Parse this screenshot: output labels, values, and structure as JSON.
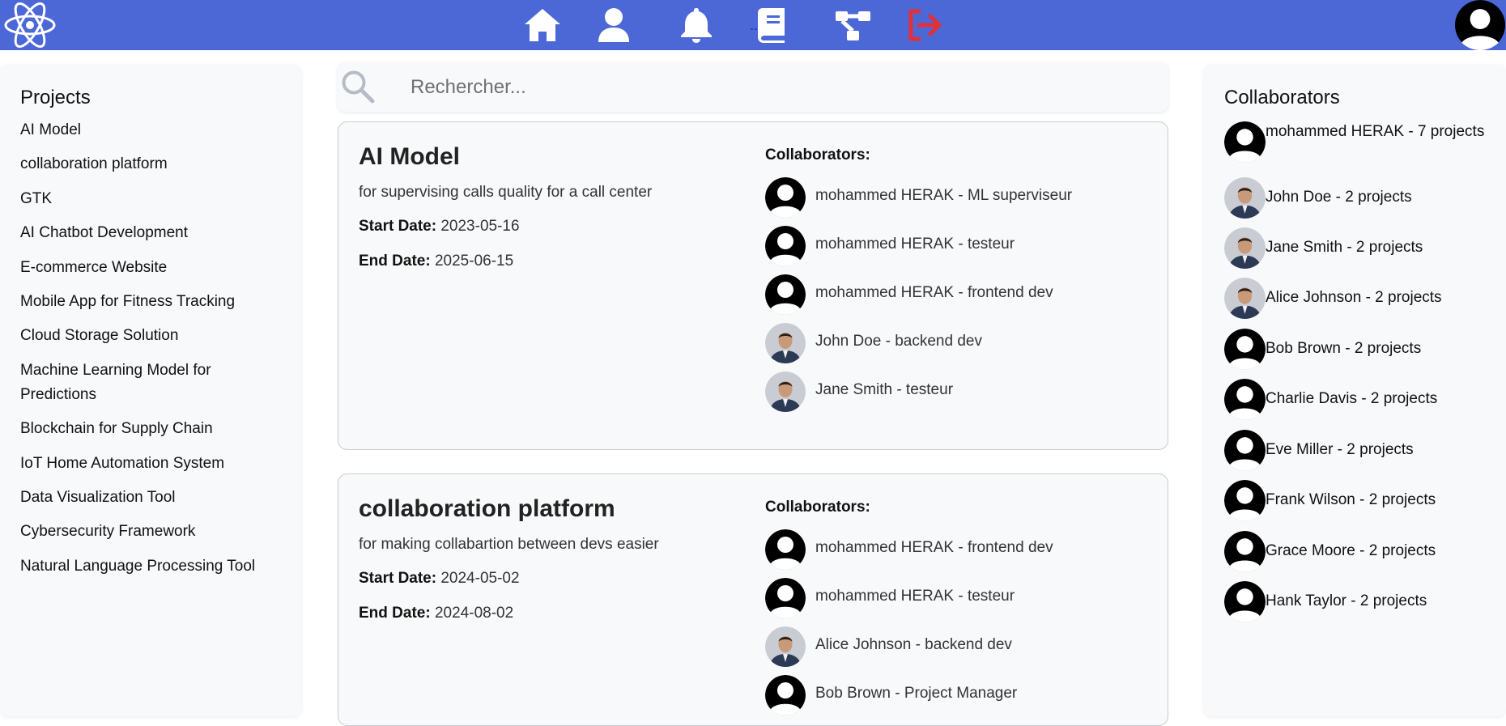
{
  "colors": {
    "topbar": "#4c68d7",
    "logout_icon": "#e0303a",
    "panel_bg": "#f8f9fb"
  },
  "nav": {
    "logo_icon": "atom-icon",
    "icons": [
      "home-icon",
      "user-icon",
      "bell-icon",
      "book-icon",
      "sitemap-icon",
      "logout-icon"
    ]
  },
  "projects_panel": {
    "title": "Projects",
    "items": [
      "AI Model",
      "collaboration platform",
      "GTK",
      "AI Chatbot Development",
      "E-commerce Website",
      "Mobile App for Fitness Tracking",
      "Cloud Storage Solution",
      "Machine Learning Model for Predictions",
      "Blockchain for Supply Chain",
      "IoT Home Automation System",
      "Data Visualization Tool",
      "Cybersecurity Framework",
      "Natural Language Processing Tool"
    ]
  },
  "search": {
    "placeholder": "Rechercher..."
  },
  "cards": [
    {
      "title": "AI Model",
      "description": "for supervising calls quality for a call center",
      "start_label": "Start Date:",
      "start_date": "2023-05-16",
      "end_label": "End Date:",
      "end_date": "2025-06-15",
      "collaborators_label": "Collaborators:",
      "collaborators": [
        {
          "name": "mohammed HERAK - ML superviseur",
          "avatar": "default"
        },
        {
          "name": "mohammed HERAK - testeur",
          "avatar": "default"
        },
        {
          "name": "mohammed HERAK - frontend dev",
          "avatar": "default"
        },
        {
          "name": "John Doe - backend dev",
          "avatar": "photo"
        },
        {
          "name": "Jane Smith - testeur",
          "avatar": "photo"
        }
      ]
    },
    {
      "title": "collaboration platform",
      "description": "for making collabartion between devs easier",
      "start_label": "Start Date:",
      "start_date": "2024-05-02",
      "end_label": "End Date:",
      "end_date": "2024-08-02",
      "collaborators_label": "Collaborators:",
      "collaborators": [
        {
          "name": "mohammed HERAK - frontend dev",
          "avatar": "default"
        },
        {
          "name": "mohammed HERAK - testeur",
          "avatar": "default"
        },
        {
          "name": "Alice Johnson - backend dev",
          "avatar": "photo"
        },
        {
          "name": "Bob Brown - Project Manager",
          "avatar": "default"
        }
      ]
    }
  ],
  "collaborators_panel": {
    "title": "Collaborators",
    "items": [
      {
        "label": "mohammed HERAK - 7 projects",
        "avatar": "default"
      },
      {
        "label": "John Doe - 2 projects",
        "avatar": "photo"
      },
      {
        "label": "Jane Smith - 2 projects",
        "avatar": "photo"
      },
      {
        "label": "Alice Johnson - 2 projects",
        "avatar": "photo"
      },
      {
        "label": "Bob Brown - 2 projects",
        "avatar": "default"
      },
      {
        "label": "Charlie Davis - 2 projects",
        "avatar": "default"
      },
      {
        "label": "Eve Miller - 2 projects",
        "avatar": "default"
      },
      {
        "label": "Frank Wilson - 2 projects",
        "avatar": "default"
      },
      {
        "label": "Grace Moore - 2 projects",
        "avatar": "default"
      },
      {
        "label": "Hank Taylor - 2 projects",
        "avatar": "default"
      }
    ]
  }
}
